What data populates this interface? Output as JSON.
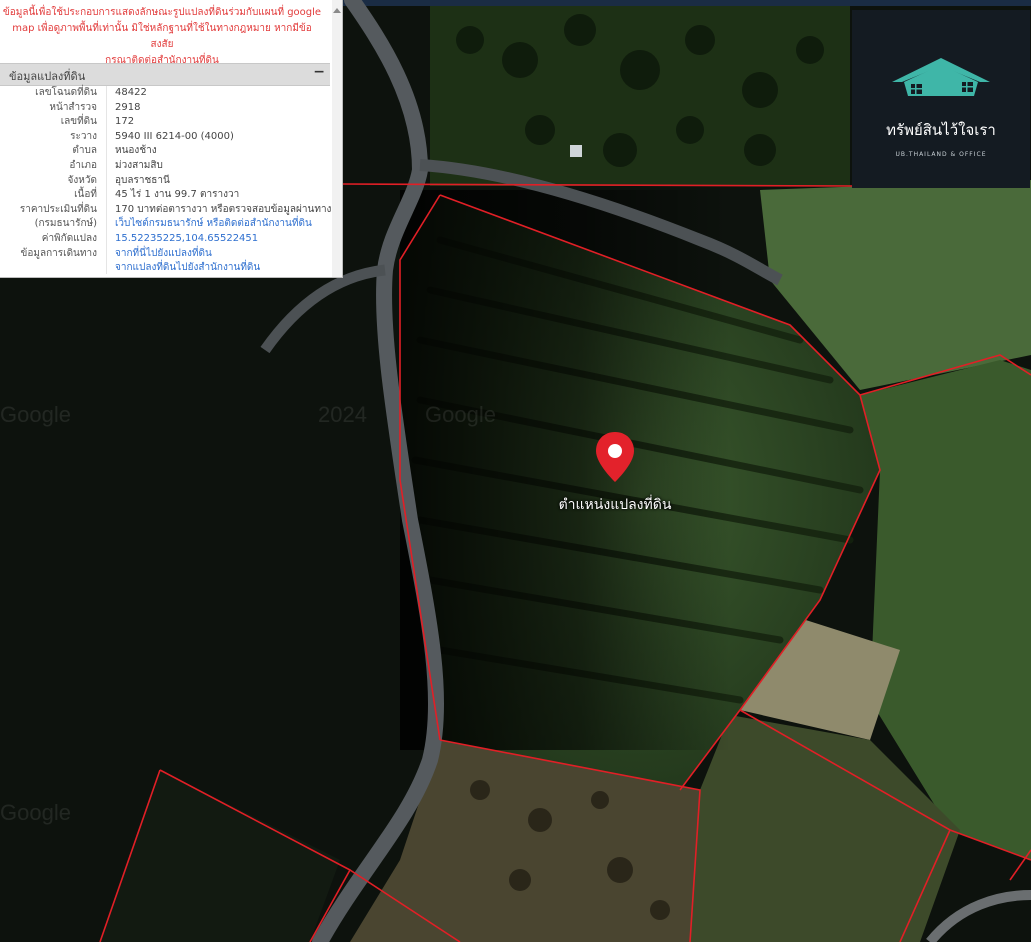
{
  "disclaimer": {
    "line1": "ข้อมูลนี้เพื่อใช้ประกอบการแสดงลักษณะรูปแปลงที่ดินร่วมกับแผนที่ google",
    "line2": "map เพื่อดูภาพพื้นที่เท่านั้น มิใช่หลักฐานที่ใช้ในทางกฎหมาย หากมีข้อสงสัย",
    "line3": "กรุณาติดต่อสำนักงานที่ดิน"
  },
  "section": {
    "title": "ข้อมูลแปลงที่ดิน",
    "collapse_symbol": "−"
  },
  "parcel": [
    {
      "label": "เลขโฉนดที่ดิน",
      "value": "48422"
    },
    {
      "label": "หน้าสำรวจ",
      "value": "2918"
    },
    {
      "label": "เลขที่ดิน",
      "value": "172"
    },
    {
      "label": "ระวาง",
      "value": "5940 III 6214-00 (4000)"
    },
    {
      "label": "ตำบล",
      "value": "หนองช้าง"
    },
    {
      "label": "อำเภอ",
      "value": "ม่วงสามสิบ"
    },
    {
      "label": "จังหวัด",
      "value": "อุบลราชธานี"
    },
    {
      "label": "เนื้อที่",
      "value": "45 ไร่ 1 งาน 99.7 ตารางวา"
    },
    {
      "label": "ราคาประเมินที่ดิน",
      "value": "170 บาทต่อตารางวา หรือตรวจสอบข้อมูลผ่านทาง"
    },
    {
      "label": "(กรมธนารักษ์)",
      "value": "เว็บไซต์กรมธนารักษ์ หรือติดต่อสำนักงานที่ดิน"
    },
    {
      "label": "ค่าพิกัดแปลง",
      "value": "15.52235225,104.65522451"
    },
    {
      "label": "ข้อมูลการเดินทาง",
      "value": "จากที่นี่ไปยังแปลงที่ดิน"
    },
    {
      "label": "",
      "value": "จากแปลงที่ดินไปยังสำนักงานที่ดิน"
    }
  ],
  "logo": {
    "brand": "ทรัพย์สินไว้ใจเรา",
    "subtitle": "UB.THAILAND & OFFICE",
    "roof_color": "#3fb6a8"
  },
  "map": {
    "marker_label": "ตำแหน่งแปลงที่ดิน",
    "marker_color": "#e3222b",
    "boundary_color": "#e11f26",
    "watermark": "Google",
    "watermark_year": "2024"
  }
}
